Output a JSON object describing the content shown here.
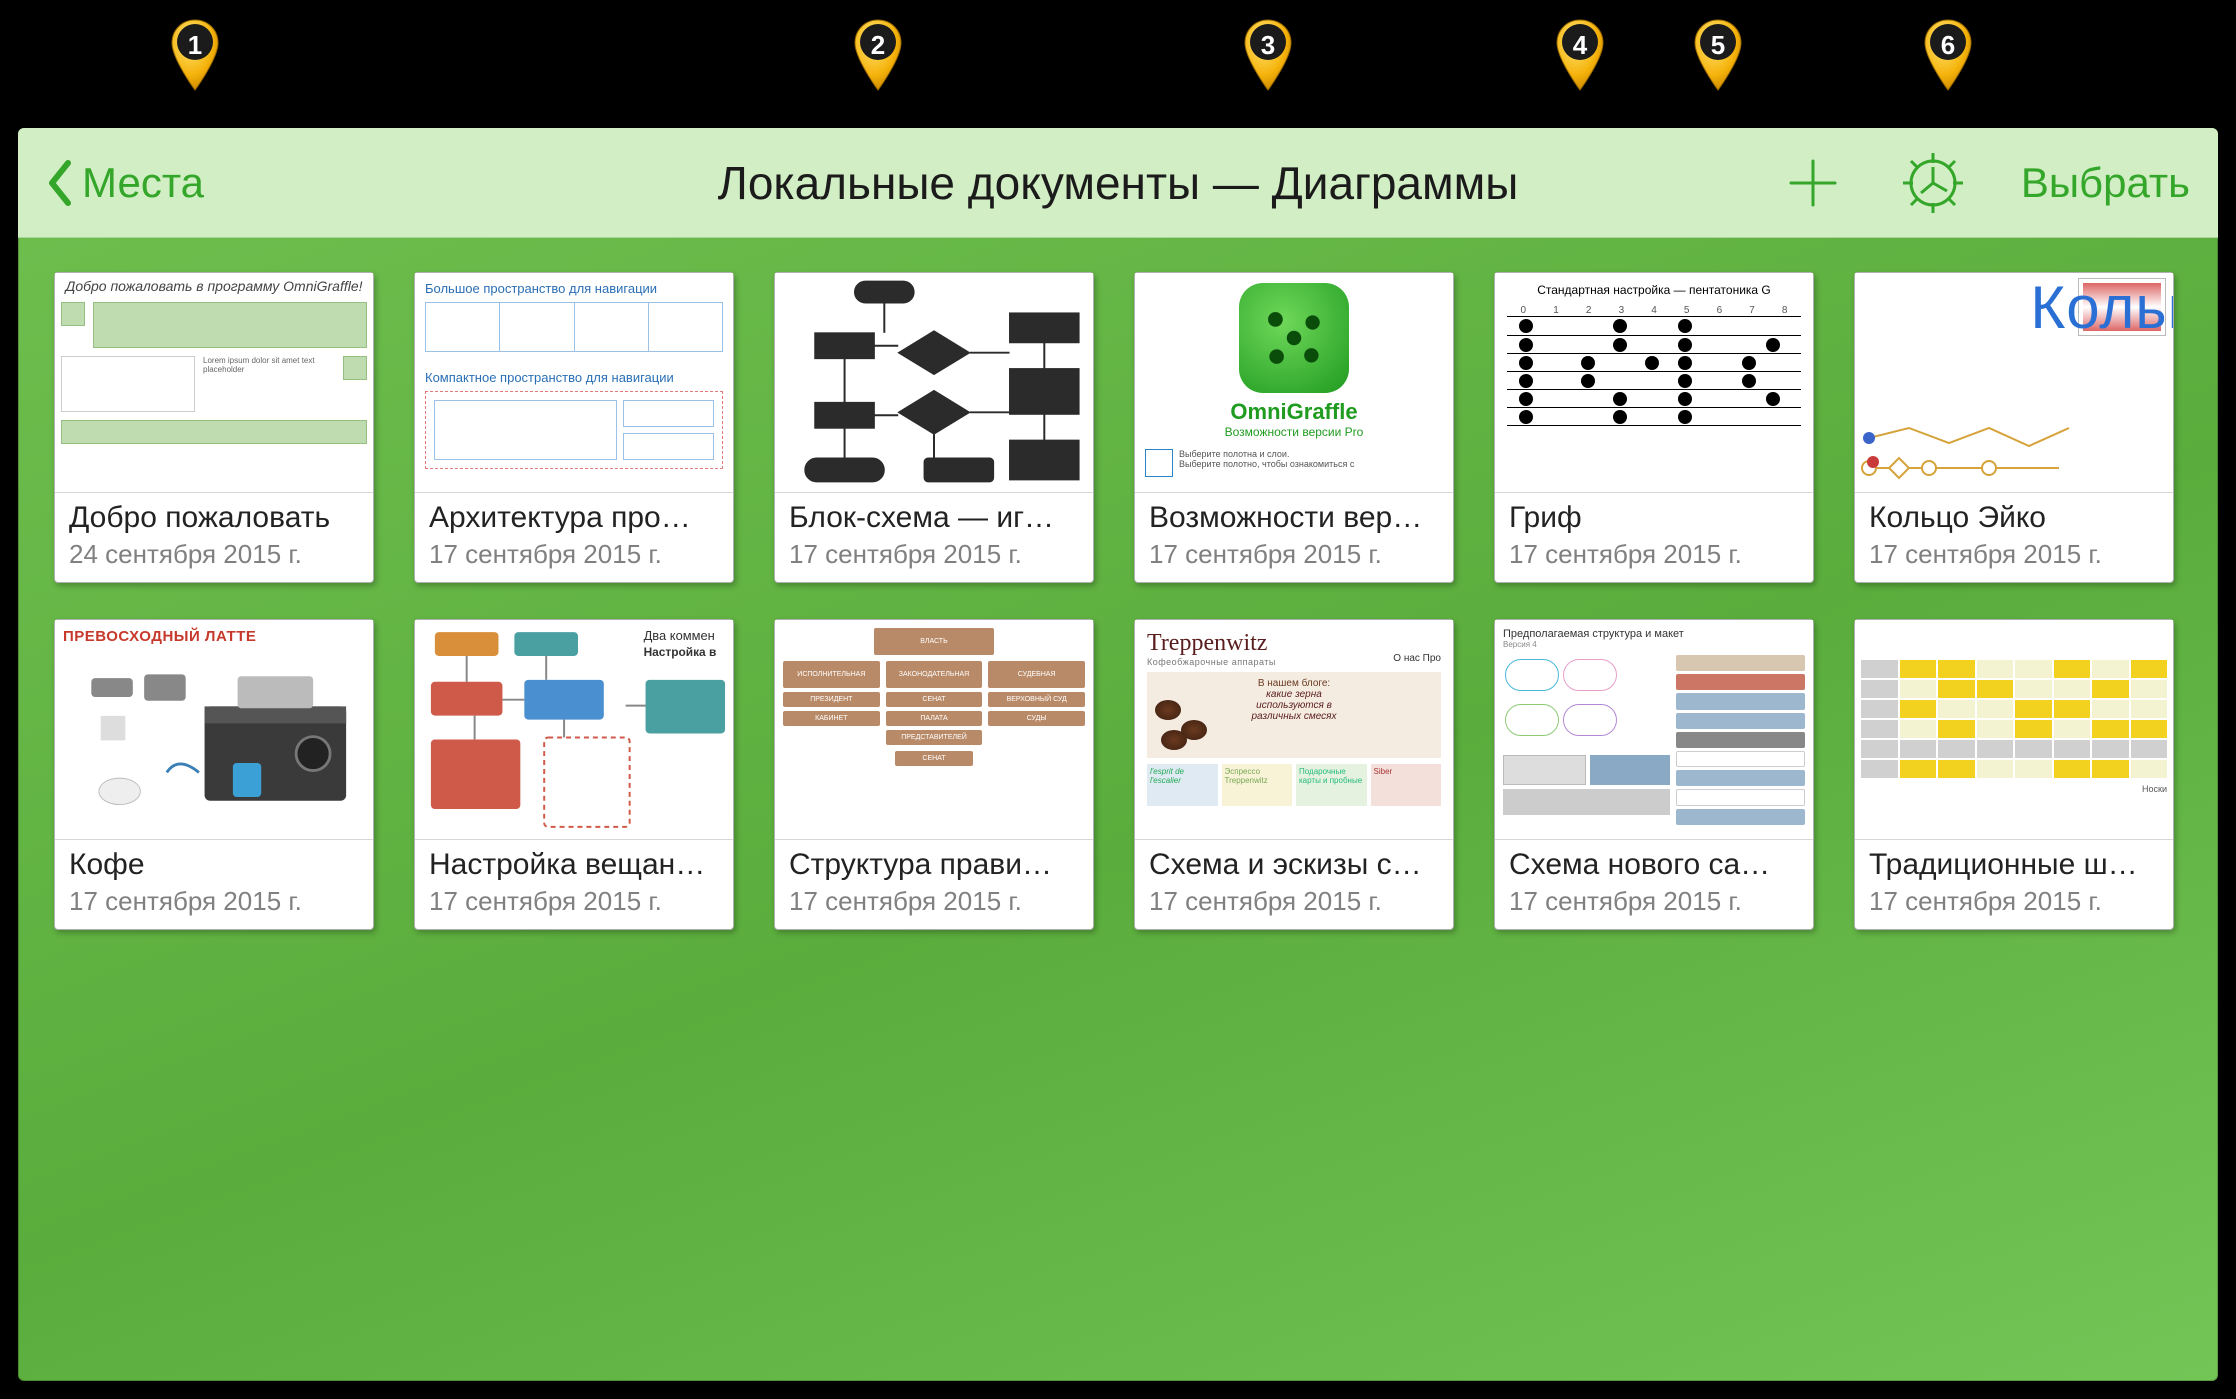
{
  "pins": [
    "1",
    "2",
    "3",
    "4",
    "5",
    "6"
  ],
  "nav": {
    "back_label": "Места",
    "title": "Локальные документы — Диаграммы",
    "select_label": "Выбрать"
  },
  "docs": [
    {
      "title": "Добро пожаловать",
      "date": "24 сентября 2015 г."
    },
    {
      "title": "Архитектура про…",
      "date": "17 сентября 2015 г."
    },
    {
      "title": "Блок-схема — иг…",
      "date": "17 сентября 2015 г."
    },
    {
      "title": "Возможности вер…",
      "date": "17 сентября 2015 г."
    },
    {
      "title": "Гриф",
      "date": "17 сентября 2015 г."
    },
    {
      "title": "Кольцо Эйко",
      "date": "17 сентября 2015 г."
    },
    {
      "title": "Кофе",
      "date": "17 сентября 2015 г."
    },
    {
      "title": "Настройка вещан…",
      "date": "17 сентября 2015 г."
    },
    {
      "title": "Структура прави…",
      "date": "17 сентября 2015 г."
    },
    {
      "title": "Схема и эскизы с…",
      "date": "17 сентября 2015 г."
    },
    {
      "title": "Схема нового са…",
      "date": "17 сентября 2015 г."
    },
    {
      "title": "Традиционные ш…",
      "date": "17 сентября 2015 г."
    }
  ],
  "thumbs": {
    "welcome_heading": "Добро пожаловать в программу OmniGraffle!",
    "arch_caption1": "Большое пространство для навигации",
    "arch_caption2": "Компактное пространство для навигации",
    "omni_name": "OmniGraffle",
    "omni_sub": "Возможности версии Pro",
    "omni_foot1": "Выберите полотна и слои.",
    "omni_foot2": "Выберите полотно, чтобы ознакомиться с",
    "fret_title": "Стандартная настройка — пентатоника G",
    "ring_word": "Кольц",
    "coffee_title": "ПРЕВОСХОДНЫЙ ЛАТТЕ",
    "broadcast_title": "Два коммен",
    "broadcast_sub": "Настройка в",
    "trep_name": "Treppenwitz",
    "trep_sub": "Кофеобжарочные аппараты",
    "trep_nav": "О нас    Про",
    "trep_blog": "В нашем блоге:",
    "trep_line1": "какие зерна",
    "trep_line2": "используются в",
    "trep_line3": "различных смесях",
    "layout_title": "Предполагаемая структура и макет",
    "layout_sub": "Версия 4",
    "gantt_foot": "Носки"
  }
}
